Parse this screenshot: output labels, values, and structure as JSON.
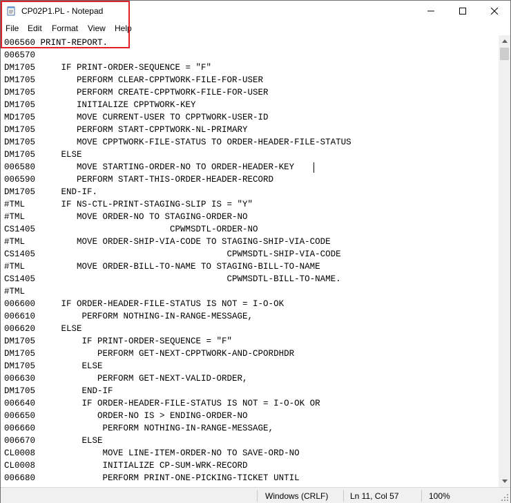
{
  "window": {
    "title": "CP02P1.PL - Notepad"
  },
  "menu": {
    "file": "File",
    "edit": "Edit",
    "format": "Format",
    "view": "View",
    "help": "Help"
  },
  "editor": {
    "lines": [
      "006560 PRINT-REPORT.",
      "006570",
      "DM1705     IF PRINT-ORDER-SEQUENCE = \"F\"",
      "DM1705        PERFORM CLEAR-CPPTWORK-FILE-FOR-USER",
      "DM1705        PERFORM CREATE-CPPTWORK-FILE-FOR-USER",
      "DM1705        INITIALIZE CPPTWORK-KEY",
      "MD1705        MOVE CURRENT-USER TO CPPTWORK-USER-ID",
      "DM1705        PERFORM START-CPPTWORK-NL-PRIMARY",
      "DM1705        MOVE CPPTWORK-FILE-STATUS TO ORDER-HEADER-FILE-STATUS",
      "DM1705     ELSE",
      "006580        MOVE STARTING-ORDER-NO TO ORDER-HEADER-KEY",
      "006590        PERFORM START-THIS-ORDER-HEADER-RECORD",
      "DM1705     END-IF.",
      "#TML       IF NS-CTL-PRINT-STAGING-SLIP IS = \"Y\"",
      "#TML          MOVE ORDER-NO TO STAGING-ORDER-NO",
      "CS1405                          CPWMSDTL-ORDER-NO",
      "#TML          MOVE ORDER-SHIP-VIA-CODE TO STAGING-SHIP-VIA-CODE",
      "CS1405                                     CPWMSDTL-SHIP-VIA-CODE",
      "#TML          MOVE ORDER-BILL-TO-NAME TO STAGING-BILL-TO-NAME",
      "CS1405                                     CPWMSDTL-BILL-TO-NAME.",
      "#TML",
      "006600     IF ORDER-HEADER-FILE-STATUS IS NOT = I-O-OK",
      "006610         PERFORM NOTHING-IN-RANGE-MESSAGE,",
      "006620     ELSE",
      "DM1705         IF PRINT-ORDER-SEQUENCE = \"F\"",
      "DM1705            PERFORM GET-NEXT-CPPTWORK-AND-CPORDHDR",
      "DM1705         ELSE",
      "006630            PERFORM GET-NEXT-VALID-ORDER,",
      "DM1705         END-IF",
      "006640         IF ORDER-HEADER-FILE-STATUS IS NOT = I-O-OK OR",
      "006650            ORDER-NO IS > ENDING-ORDER-NO",
      "006660             PERFORM NOTHING-IN-RANGE-MESSAGE,",
      "006670         ELSE",
      "CL0008             MOVE LINE-ITEM-ORDER-NO TO SAVE-ORD-NO",
      "CL0008             INITIALIZE CP-SUM-WRK-RECORD",
      "006680             PERFORM PRINT-ONE-PICKING-TICKET UNTIL"
    ]
  },
  "status": {
    "encoding": "Windows (CRLF)",
    "position": "Ln 11, Col 57",
    "zoom": "100%"
  },
  "colors": {
    "highlight": "#e0202a",
    "statusbar": "#f0f0f0"
  }
}
